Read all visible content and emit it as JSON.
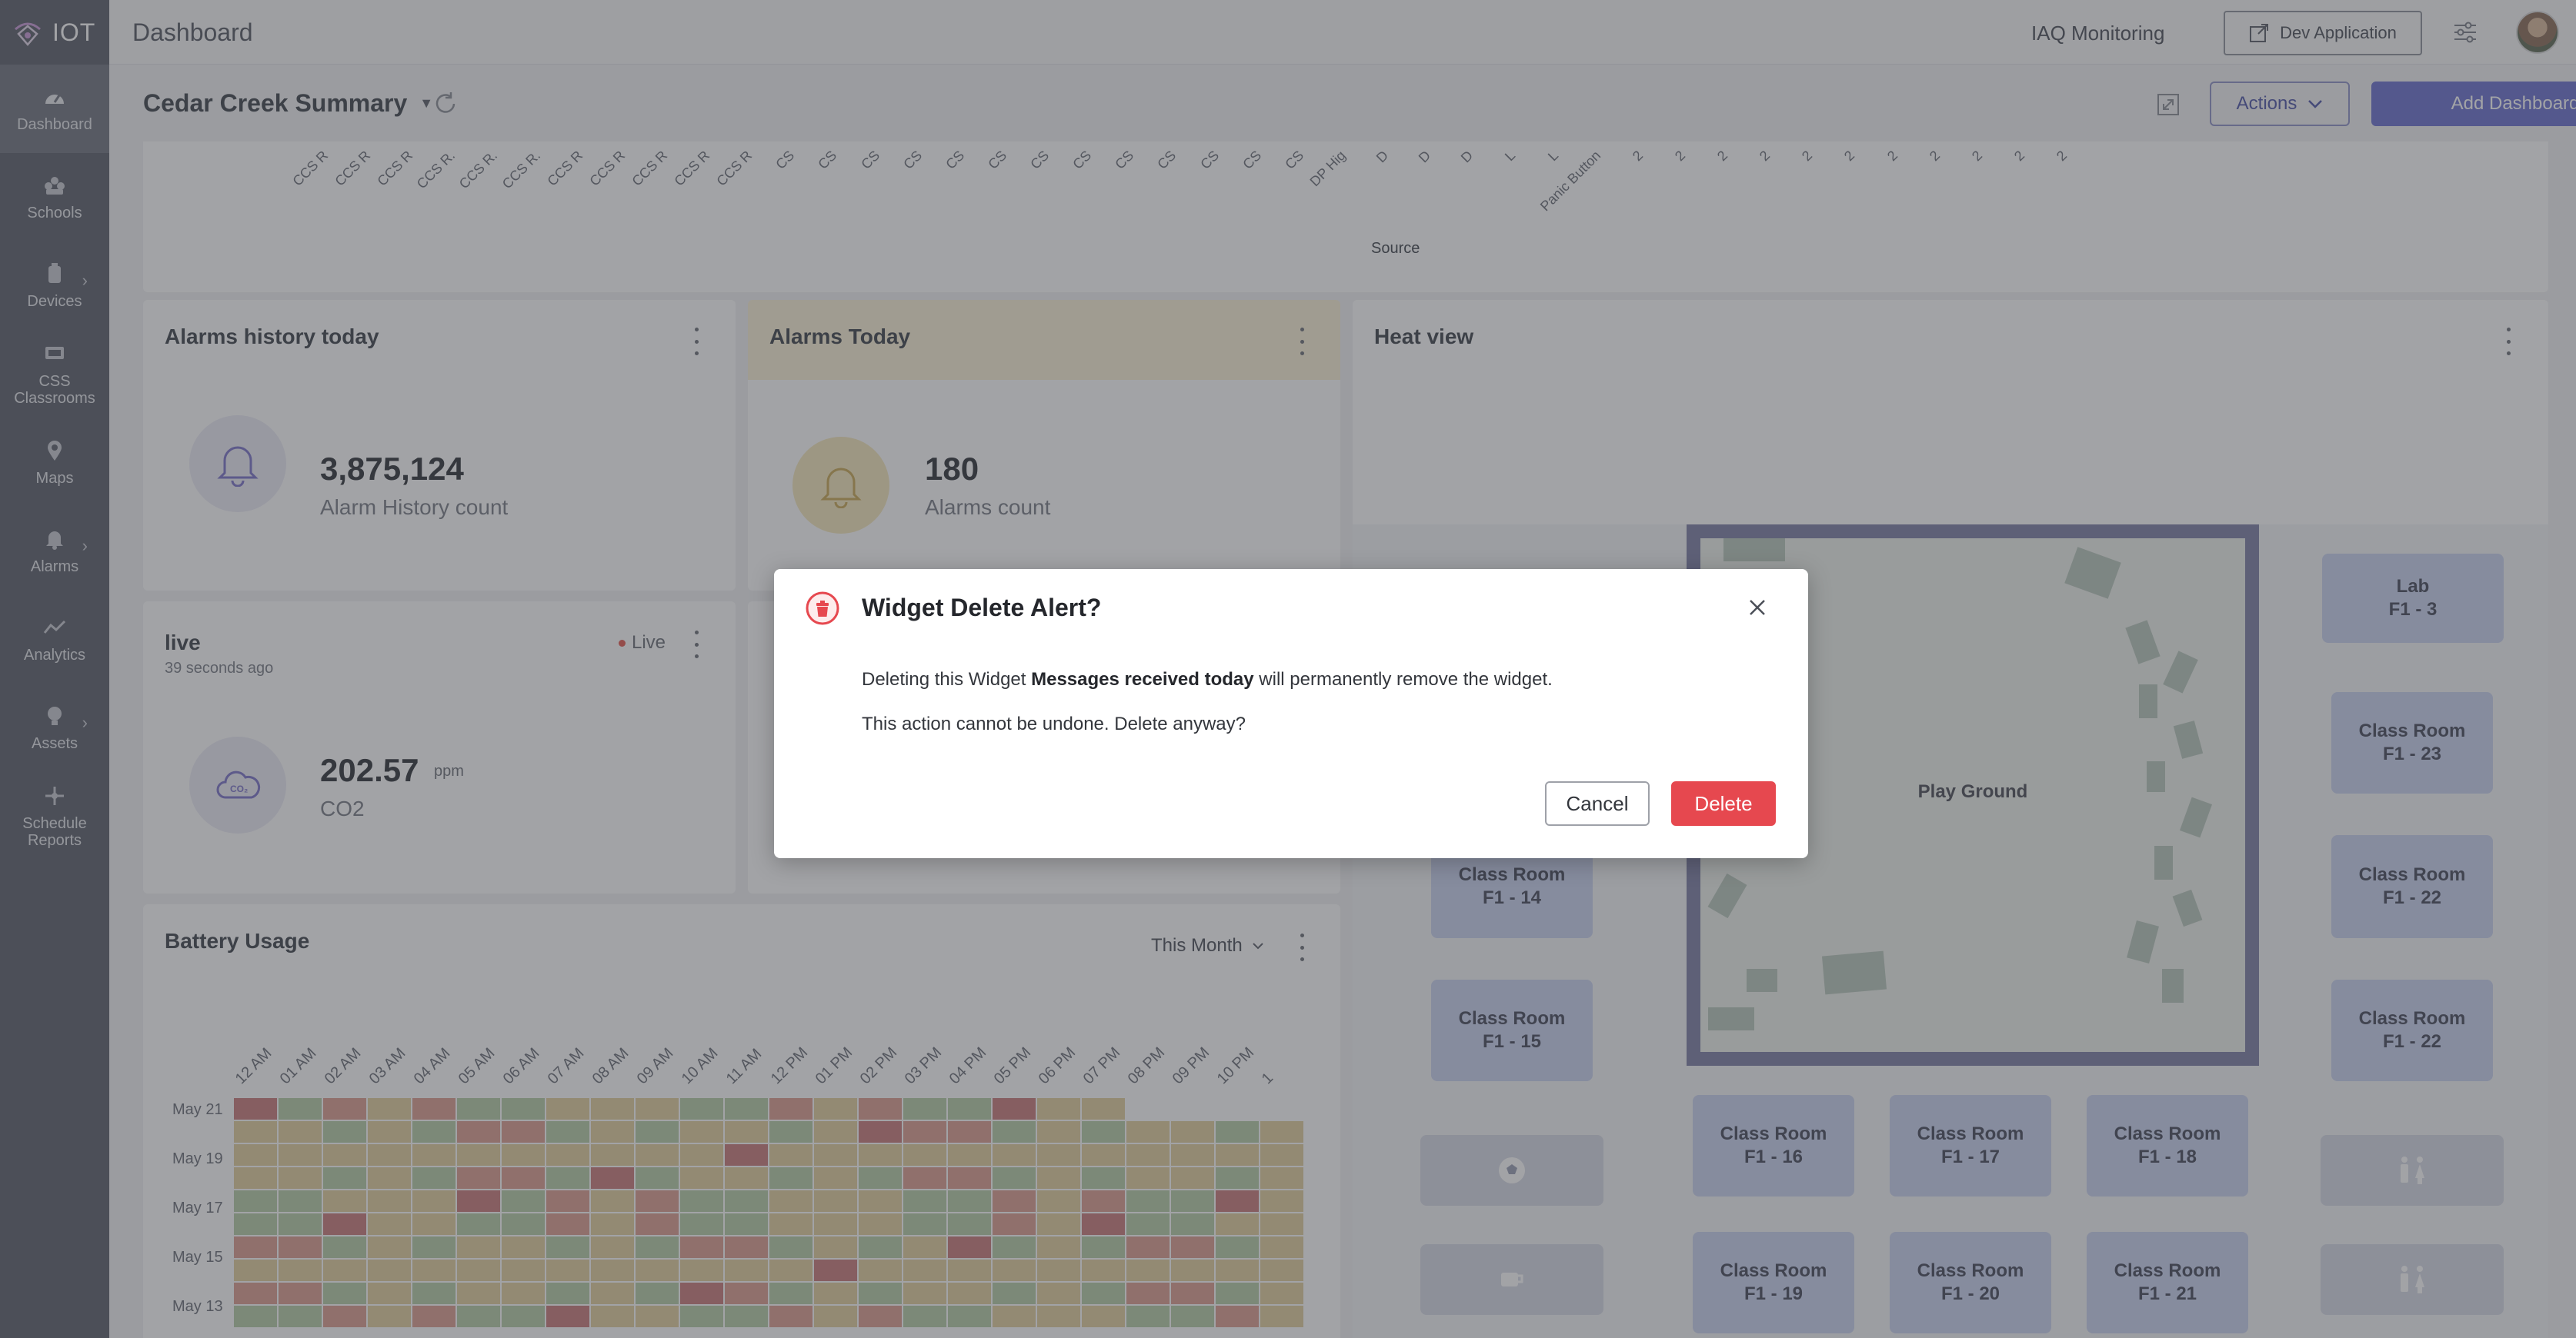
{
  "app": {
    "brand": "IOT",
    "page_title": "Dashboard"
  },
  "sidebar": {
    "items": [
      {
        "label": "Dashboard",
        "icon": "dashboard-icon",
        "active": true
      },
      {
        "label": "Schools",
        "icon": "schools-icon"
      },
      {
        "label": "Devices",
        "icon": "devices-icon",
        "has_children": true
      },
      {
        "label": "CSS Classrooms",
        "icon": "classrooms-icon"
      },
      {
        "label": "Maps",
        "icon": "map-pin-icon"
      },
      {
        "label": "Alarms",
        "icon": "bell-icon",
        "has_children": true
      },
      {
        "label": "Analytics",
        "icon": "analytics-icon"
      },
      {
        "label": "Assets",
        "icon": "assets-icon",
        "has_children": true
      },
      {
        "label": "Schedule Reports",
        "icon": "schedule-icon"
      }
    ]
  },
  "topbar": {
    "iaq": "IAQ Monitoring",
    "dev_app": "Dev Application"
  },
  "dashboard": {
    "name": "Cedar Creek Summary",
    "actions": "Actions",
    "add": "Add Dashboard"
  },
  "source_chart": {
    "axis_label": "Source",
    "ticks": [
      "CCS R",
      "CCS R",
      "CCS R",
      "CCS R.",
      "CCS R.",
      "CCS R.",
      "CCS R",
      "CCS R",
      "CCS R",
      "CCS R",
      "CCS R",
      "CS",
      "CS",
      "CS",
      "CS",
      "CS",
      "CS",
      "CS",
      "CS",
      "CS",
      "CS",
      "CS",
      "CS",
      "CS",
      "DP Hig",
      "D",
      "D",
      "D",
      "L",
      "L",
      "Panic Button",
      "2",
      "2",
      "2",
      "2",
      "2",
      "2",
      "2",
      "2",
      "2",
      "2",
      "2"
    ]
  },
  "alarms_history": {
    "title": "Alarms history today",
    "value": "3,875,124",
    "label": "Alarm History count"
  },
  "alarms_today": {
    "title": "Alarms Today",
    "value": "180",
    "label": "Alarms count"
  },
  "live": {
    "title": "live",
    "ago": "39 seconds ago",
    "status": "Live",
    "value": "202.57",
    "unit": "ppm",
    "label": "CO2"
  },
  "battery": {
    "title": "Battery Usage",
    "range": "This Month",
    "columns": [
      "12 AM",
      "01 AM",
      "02 AM",
      "03 AM",
      "04 AM",
      "05 AM",
      "06 AM",
      "07 AM",
      "08 AM",
      "09 AM",
      "10 AM",
      "11 AM",
      "12 PM",
      "01 PM",
      "02 PM",
      "03 PM",
      "04 PM",
      "05 PM",
      "06 PM",
      "07 PM",
      "08 PM",
      "09 PM",
      "10 PM",
      "1"
    ],
    "row_labels": [
      "May 21",
      "May 19",
      "May 17",
      "May 15",
      "May 13"
    ],
    "colors": {
      "green": "#b7cda8",
      "tan": "#e2cf9e",
      "red": "#dc9d91",
      "darkred": "#c97b7b"
    }
  },
  "heat_view": {
    "title": "Heat view",
    "playground": "Play Ground",
    "rooms": [
      {
        "line1": "Lab",
        "line2": "F1 - 3"
      },
      {
        "line1": "Class Room",
        "line2": "F1 - 23"
      },
      {
        "line1": "Class Room",
        "line2": "F1 - 14"
      },
      {
        "line1": "Class Room",
        "line2": "F1 - 22"
      },
      {
        "line1": "Class Room",
        "line2": "F1 - 15"
      },
      {
        "line1": "Class Room",
        "line2": "F1 - 22"
      },
      {
        "line1": "Class Room",
        "line2": "F1 - 16"
      },
      {
        "line1": "Class Room",
        "line2": "F1 - 17"
      },
      {
        "line1": "Class Room",
        "line2": "F1 - 18"
      },
      {
        "line1": "Class Room",
        "line2": "F1 - 19"
      },
      {
        "line1": "Class Room",
        "line2": "F1 - 20"
      },
      {
        "line1": "Class Room",
        "line2": "F1 - 21"
      }
    ]
  },
  "modal": {
    "title": "Widget Delete Alert?",
    "line1_pre": "Deleting this Widget ",
    "line1_bold": "Messages received today",
    "line1_post": " will permanently remove the widget.",
    "line2": "This action cannot be undone. Delete anyway?",
    "cancel": "Cancel",
    "delete": "Delete"
  }
}
